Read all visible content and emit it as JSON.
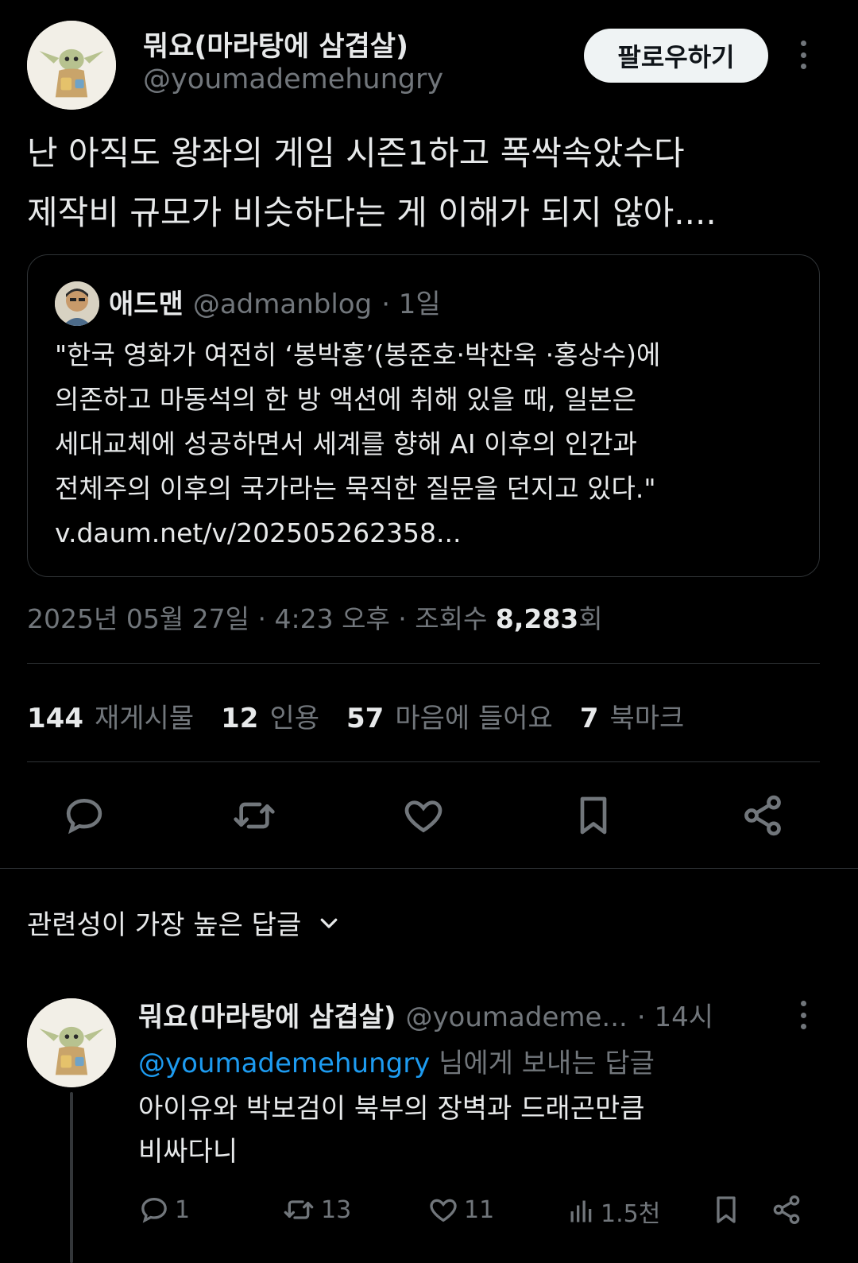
{
  "tweet": {
    "author_name": "뭐요(마라탕에 삼겹살)",
    "author_handle": "@youmademehungry",
    "follow_label": "팔로우하기",
    "text_lines": [
      "난 아직도 왕좌의 게임 시즌1하고 폭싹속았수다",
      "제작비 규모가 비슷하다는 게 이해가 되지 않아...."
    ],
    "quote": {
      "name": "애드맨",
      "handle": "@admanblog",
      "time": "· 1일",
      "text_lines": [
        "\"한국 영화가 여전히 ‘봉박홍’(봉준호·박찬욱 ·홍상수)에",
        "의존하고 마동석의 한 방 액션에 취해 있을 때, 일본은",
        "세대교체에 성공하면서 세계를 향해 AI 이후의 인간과",
        "전체주의 이후의 국가라는 묵직한 질문을 던지고 있다.\"",
        "v.daum.net/v/202505262358..."
      ]
    },
    "date": "2025년 05월 27일 · 4:23 오후 · 조회수",
    "views": "8,283",
    "views_suffix": "회",
    "stats": {
      "retweets_count": "144",
      "retweets_label": "재게시물",
      "quotes_count": "12",
      "quotes_label": "인용",
      "likes_count": "57",
      "likes_label": "마음에 들어요",
      "bookmarks_count": "7",
      "bookmarks_label": "북마크"
    },
    "actions": [
      "reply-icon",
      "retweet-icon",
      "heart-icon",
      "bookmark-icon",
      "share-icon"
    ]
  },
  "replies_section": {
    "title": "관련성이 가장 높은 답글"
  },
  "reply": {
    "author_name": "뭐요(마라탕에 삼겹살)",
    "author_handle": "@youmademe...",
    "time": "· 14시",
    "reply_to_mention": "@youmademehungry",
    "reply_to_suffix": "님에게 보내는 답글",
    "text_lines": [
      "아이유와 박보검이 북부의 장벽과 드래곤만큼",
      "비싸다니"
    ],
    "actions": {
      "replies": "1",
      "retweets": "13",
      "likes": "11",
      "views": "1.5천"
    }
  },
  "colors": {
    "background": "#000000",
    "text": "#e7e9ea",
    "muted": "#71767b",
    "border": "#2f3336",
    "link": "#1d9bf0"
  }
}
